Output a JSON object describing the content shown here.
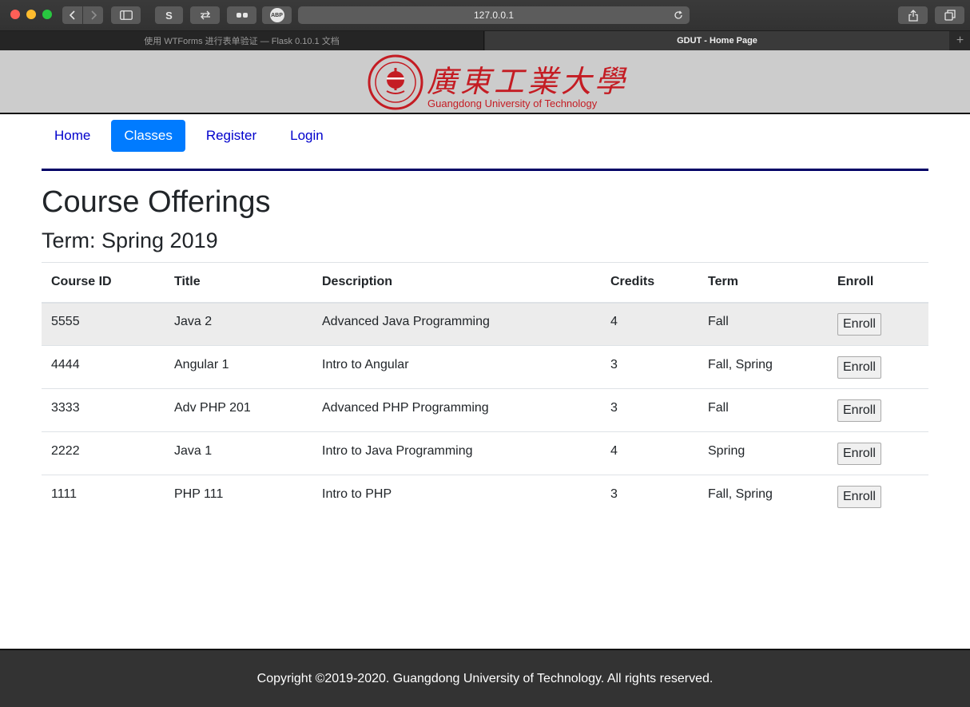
{
  "browser": {
    "url": "127.0.0.1",
    "extension_labels": {
      "s": "S",
      "abp": "ABP"
    },
    "tabs": [
      {
        "label": "使用 WTForms 进行表单验证 — Flask 0.10.1 文档",
        "active": false
      },
      {
        "label": "GDUT - Home Page",
        "active": true
      }
    ],
    "new_tab_label": "+"
  },
  "banner": {
    "logo_chinese": "廣東工業大學",
    "logo_english": "Guangdong University of Technology",
    "brand_color": "#c41c23"
  },
  "nav": {
    "items": [
      {
        "label": "Home",
        "active": false
      },
      {
        "label": "Classes",
        "active": true
      },
      {
        "label": "Register",
        "active": false
      },
      {
        "label": "Login",
        "active": false
      }
    ],
    "active_color": "#007bff",
    "link_color": "#0000cc"
  },
  "main": {
    "title": "Course Offerings",
    "term_line": "Term: Spring 2019",
    "table": {
      "headers": [
        "Course ID",
        "Title",
        "Description",
        "Credits",
        "Term",
        "Enroll"
      ],
      "rows": [
        {
          "id": "5555",
          "title": "Java 2",
          "description": "Advanced Java Programming",
          "credits": "4",
          "term": "Fall",
          "enroll_label": "Enroll"
        },
        {
          "id": "4444",
          "title": "Angular 1",
          "description": "Intro to Angular",
          "credits": "3",
          "term": "Fall, Spring",
          "enroll_label": "Enroll"
        },
        {
          "id": "3333",
          "title": "Adv PHP 201",
          "description": "Advanced PHP Programming",
          "credits": "3",
          "term": "Fall",
          "enroll_label": "Enroll"
        },
        {
          "id": "2222",
          "title": "Java 1",
          "description": "Intro to Java Programming",
          "credits": "4",
          "term": "Spring",
          "enroll_label": "Enroll"
        },
        {
          "id": "1111",
          "title": "PHP 111",
          "description": "Intro to PHP",
          "credits": "3",
          "term": "Fall, Spring",
          "enroll_label": "Enroll"
        }
      ]
    }
  },
  "footer": {
    "copyright": "Copyright ©2019-2020. Guangdong University of Technology. All rights reserved."
  }
}
